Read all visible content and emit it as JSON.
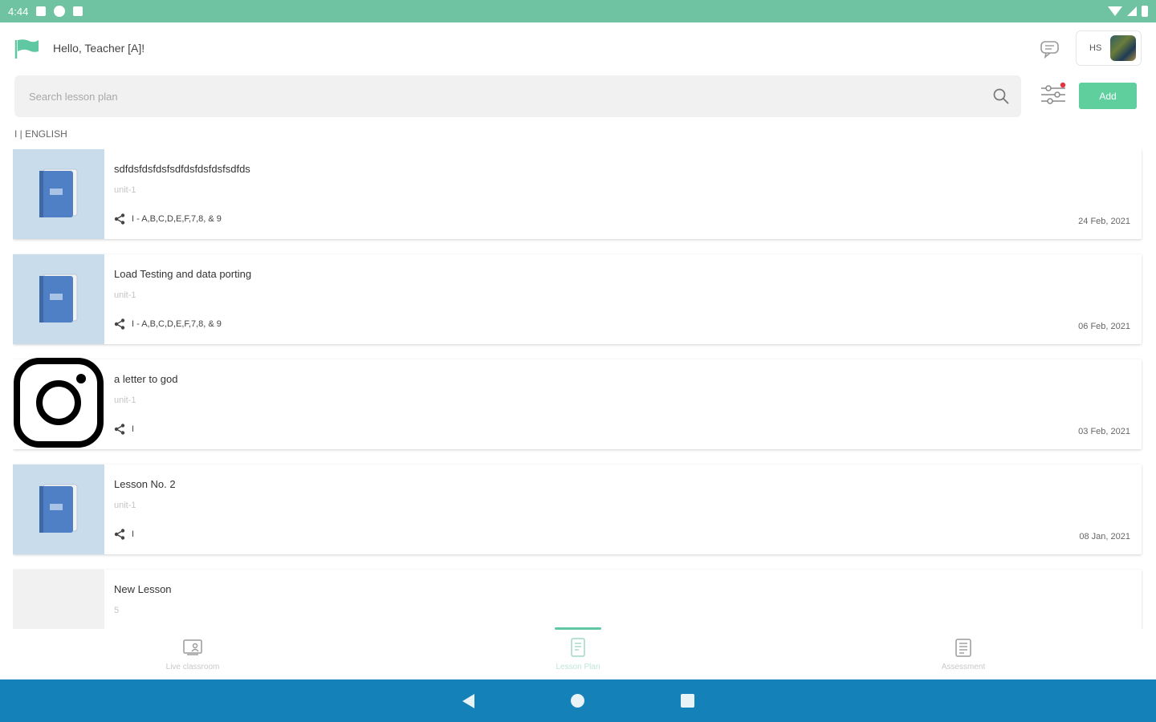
{
  "status_bar": {
    "time": "4:44"
  },
  "header": {
    "greeting": "Hello, Teacher [A]!",
    "profile_initials": "HS"
  },
  "search": {
    "placeholder": "Search lesson plan",
    "value": ""
  },
  "toolbar": {
    "add_label": "Add"
  },
  "section": {
    "label": "I | ENGLISH"
  },
  "lessons": [
    {
      "title": "sdfdsfdsfdsfsdfdsfdsfdsfsdfds",
      "unit": "unit-1",
      "share_text": "I - A,B,C,D,E,F,7,8, & 9",
      "date": "24 Feb, 2021",
      "thumbnail": "book-icon"
    },
    {
      "title": "Load Testing and data porting",
      "unit": "unit-1",
      "share_text": "I - A,B,C,D,E,F,7,8, & 9",
      "date": "06 Feb, 2021",
      "thumbnail": "book-icon"
    },
    {
      "title": "a letter to god",
      "unit": "unit-1",
      "share_text": "I",
      "date": "03 Feb, 2021",
      "thumbnail": "instagram-icon"
    },
    {
      "title": "Lesson No. 2",
      "unit": "unit-1",
      "share_text": "I",
      "date": "08 Jan, 2021",
      "thumbnail": "book-icon"
    },
    {
      "title": "New Lesson",
      "unit": "5",
      "share_text": "",
      "date": "",
      "thumbnail": "empty"
    }
  ],
  "bottom_nav": [
    {
      "label": "Live classroom",
      "icon": "live-classroom-icon",
      "active": false
    },
    {
      "label": "Lesson Plan",
      "icon": "lesson-plan-icon",
      "active": true
    },
    {
      "label": "Assessment",
      "icon": "assessment-icon",
      "active": false
    }
  ],
  "colors": {
    "status_bar": "#6fc3a2",
    "accent": "#5fcf9e",
    "system_nav": "#1581b9",
    "thumbnail_bg": "#c8dcec",
    "book_blue": "#4f7fc4"
  }
}
